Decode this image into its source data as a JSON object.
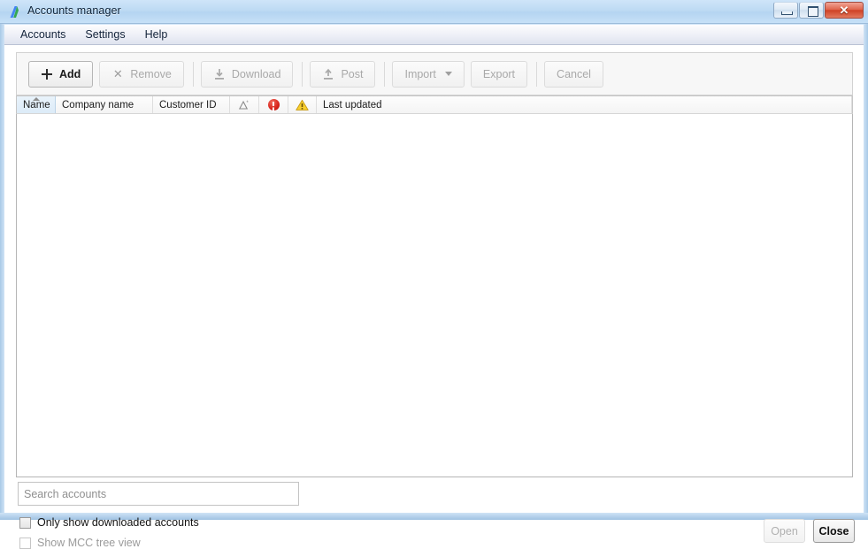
{
  "window": {
    "title": "Accounts manager",
    "app_icon": "adwords-a-icon",
    "controls": {
      "minimize": "minimize-icon",
      "maximize": "maximize-icon",
      "close": "✕"
    }
  },
  "menubar": {
    "items": [
      {
        "label": "Accounts"
      },
      {
        "label": "Settings"
      },
      {
        "label": "Help"
      }
    ]
  },
  "toolbar": {
    "buttons": [
      {
        "label": "Add",
        "icon": "plus-icon",
        "enabled": true
      },
      {
        "label": "Remove",
        "icon": "x-icon",
        "enabled": false
      },
      {
        "label": "Download",
        "icon": "download-icon",
        "enabled": false
      },
      {
        "label": "Post",
        "icon": "upload-icon",
        "enabled": false
      },
      {
        "label": "Import",
        "icon": "chevron-down-icon",
        "enabled": false
      },
      {
        "label": "Export",
        "icon": "",
        "enabled": false
      },
      {
        "label": "Cancel",
        "icon": "",
        "enabled": false
      }
    ]
  },
  "grid": {
    "columns": [
      {
        "label": "Name",
        "sorted": true,
        "sort_direction": "asc",
        "type": "text"
      },
      {
        "label": "Company name",
        "sorted": false,
        "type": "text"
      },
      {
        "label": "Customer ID",
        "sorted": false,
        "type": "text"
      },
      {
        "label": "",
        "sorted": false,
        "type": "icon",
        "icon": "changes-delta-icon"
      },
      {
        "label": "",
        "sorted": false,
        "type": "icon",
        "icon": "error-icon"
      },
      {
        "label": "",
        "sorted": false,
        "type": "icon",
        "icon": "warning-icon"
      },
      {
        "label": "Last updated",
        "sorted": false,
        "type": "text"
      }
    ],
    "rows": []
  },
  "search": {
    "value": "",
    "placeholder": "Search accounts"
  },
  "options": {
    "only_downloaded": {
      "label": "Only show downloaded accounts",
      "checked": false,
      "enabled": true
    },
    "mcc_tree_view": {
      "label": "Show MCC tree view",
      "checked": false,
      "enabled": false
    }
  },
  "footer": {
    "open_label": "Open",
    "close_label": "Close"
  },
  "colors": {
    "titlebar": "#bcd9f3",
    "accent_sort": "#dcebf8",
    "error": "#d8231b",
    "warning": "#f5c518",
    "close_button": "#cf4226"
  }
}
